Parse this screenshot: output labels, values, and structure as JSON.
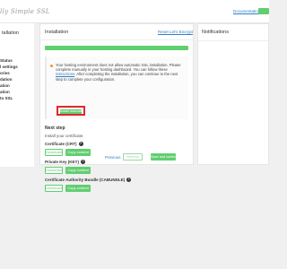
{
  "header": {
    "logo_text": "lly Simple SSL",
    "documentation_label": "Documentation",
    "accent_color": "#61ce70"
  },
  "sidebar": {
    "title": "tallation",
    "items": [
      {
        "label": "Status"
      },
      {
        "label": "l settings"
      },
      {
        "label": "ories"
      },
      {
        "label": "dation"
      },
      {
        "label": "ation"
      },
      {
        "label": "ation"
      },
      {
        "label": "to SSL"
      }
    ]
  },
  "main": {
    "title": "Installation",
    "reset_label": "Reset Let's Encrypt",
    "progress_percent": 100,
    "notice": {
      "icon": "warning-icon",
      "text_before": "Your hosting environment does not allow automatic SSL installation. Please complete manually in your hosting dashboard. You can follow these ",
      "link_label": "instructions",
      "text_after": ". After completing the installation, you can continue to the next step to complete your configuration.",
      "install_button_label": "Install manually"
    },
    "next_step_title": "Next step",
    "install_text": "Install your certificate.",
    "certificates": [
      {
        "label": "Certificate (CRT)",
        "download_label": "Download",
        "copy_label": "Copy content"
      },
      {
        "label": "Private Key (KEY)",
        "download_label": "Download",
        "copy_label": "Copy content"
      },
      {
        "label": "Certificate Authority Bundle (CABUNDLE)",
        "download_label": "Download",
        "copy_label": "Copy content"
      }
    ],
    "footer": {
      "previous_label": "Previous",
      "refresh_label": "Refresh",
      "save_label": "Save and continue"
    }
  },
  "notifications": {
    "title": "Notifications"
  }
}
